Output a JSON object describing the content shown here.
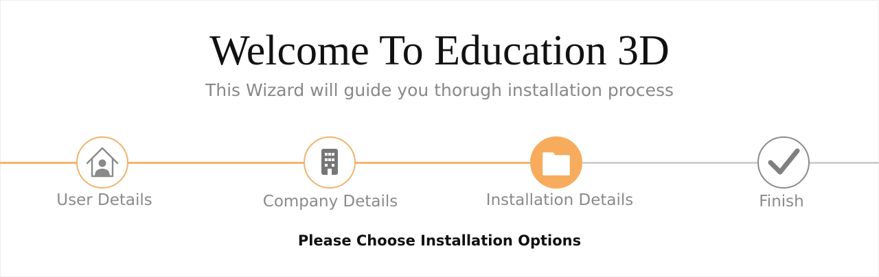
{
  "header": {
    "title": "Welcome To Education 3D",
    "subtitle": "This Wizard will guide you thorugh installation process"
  },
  "wizard": {
    "progress_color": "#f4b36a",
    "pending_color": "#cfcfcf",
    "steps": [
      {
        "label": "User Details",
        "icon": "home-user-icon",
        "state": "complete"
      },
      {
        "label": "Company Details",
        "icon": "building-icon",
        "state": "complete"
      },
      {
        "label": "Installation Details",
        "icon": "folder-icon",
        "state": "active"
      },
      {
        "label": "Finish",
        "icon": "checkmark-icon",
        "state": "pending"
      }
    ]
  },
  "main": {
    "prompt": "Please Choose Installation Options"
  }
}
